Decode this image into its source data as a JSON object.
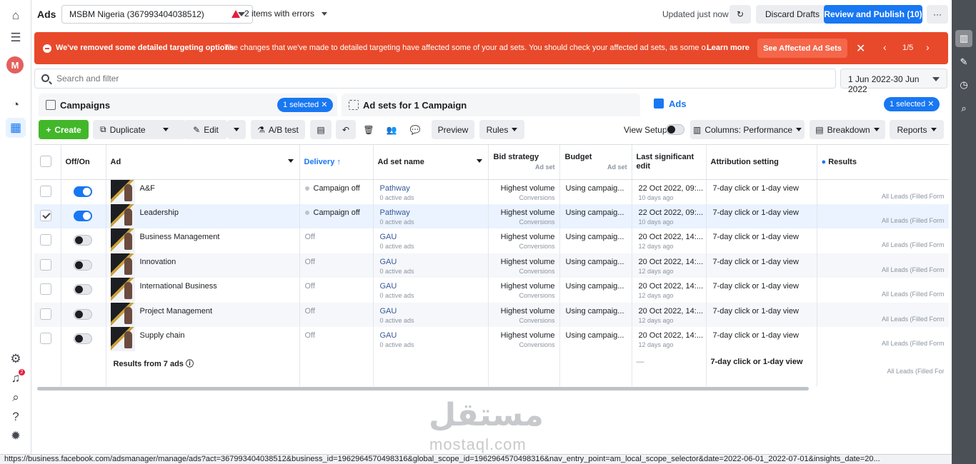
{
  "topbar": {
    "app_title": "Ads",
    "account": "MSBM Nigeria (367993404038512)",
    "errors": "2 items with errors",
    "updated": "Updated just now",
    "discard": "Discard Drafts",
    "review_publish": "Review and Publish (10)",
    "more": "···"
  },
  "banner": {
    "title": "We've removed some detailed targeting options",
    "message": "The changes that we've made to detailed targeting have affected some of your ad sets. You should check your affected ad sets, as some o...",
    "learn_more": "Learn more",
    "see_affected": "See Affected Ad Sets",
    "pager": "1/5"
  },
  "search": {
    "placeholder": "Search and filter",
    "date_range": "1 Jun 2022-30 Jun 2022"
  },
  "tabs": {
    "campaigns": "Campaigns",
    "campaigns_selected": "1 selected",
    "adsets": "Ad sets for 1 Campaign",
    "ads": "Ads",
    "ads_selected": "1 selected"
  },
  "toolbar": {
    "create": "Create",
    "duplicate": "Duplicate",
    "edit": "Edit",
    "ab_test": "A/B test",
    "preview": "Preview",
    "rules": "Rules",
    "view_setup": "View Setup",
    "columns": "Columns: Performance",
    "breakdown": "Breakdown",
    "reports": "Reports"
  },
  "table": {
    "headers": {
      "offon": "Off/On",
      "ad": "Ad",
      "delivery": "Delivery",
      "adset_name": "Ad set name",
      "bid_strategy": "Bid strategy",
      "bid_sub": "Ad set",
      "budget": "Budget",
      "budget_sub": "Ad set",
      "last_edit": "Last significant edit",
      "attribution": "Attribution setting",
      "results": "Results"
    },
    "rows": [
      {
        "ad": "A&F",
        "on": true,
        "selected": false,
        "delivery": "Campaign off",
        "adset": "Pathway",
        "adset_sub": "0 active ads",
        "bid": "Highest volume",
        "bid_sub": "Conversions",
        "budget": "Using campaig...",
        "edit": "22 Oct 2022, 09:...",
        "edit_sub": "10 days ago",
        "attribution": "7-day click or 1-day view",
        "results": "All Leads (Filled Form"
      },
      {
        "ad": "Leadership",
        "on": true,
        "selected": true,
        "delivery": "Campaign off",
        "adset": "Pathway",
        "adset_sub": "0 active ads",
        "bid": "Highest volume",
        "bid_sub": "Conversions",
        "budget": "Using campaig...",
        "edit": "22 Oct 2022, 09:...",
        "edit_sub": "10 days ago",
        "attribution": "7-day click or 1-day view",
        "results": "All Leads (Filled Form"
      },
      {
        "ad": "Business Management",
        "on": false,
        "selected": false,
        "delivery": "Off",
        "adset": "GAU",
        "adset_sub": "0 active ads",
        "bid": "Highest volume",
        "bid_sub": "Conversions",
        "budget": "Using campaig...",
        "edit": "20 Oct 2022, 14:...",
        "edit_sub": "12 days ago",
        "attribution": "7-day click or 1-day view",
        "results": "All Leads (Filled Form"
      },
      {
        "ad": "Innovation",
        "on": false,
        "selected": false,
        "delivery": "Off",
        "adset": "GAU",
        "adset_sub": "0 active ads",
        "bid": "Highest volume",
        "bid_sub": "Conversions",
        "budget": "Using campaig...",
        "edit": "20 Oct 2022, 14:...",
        "edit_sub": "12 days ago",
        "attribution": "7-day click or 1-day view",
        "results": "All Leads (Filled Form"
      },
      {
        "ad": "International Business",
        "on": false,
        "selected": false,
        "delivery": "Off",
        "adset": "GAU",
        "adset_sub": "0 active ads",
        "bid": "Highest volume",
        "bid_sub": "Conversions",
        "budget": "Using campaig...",
        "edit": "20 Oct 2022, 14:...",
        "edit_sub": "12 days ago",
        "attribution": "7-day click or 1-day view",
        "results": "All Leads (Filled Form"
      },
      {
        "ad": "Project Management",
        "on": false,
        "selected": false,
        "delivery": "Off",
        "adset": "GAU",
        "adset_sub": "0 active ads",
        "bid": "Highest volume",
        "bid_sub": "Conversions",
        "budget": "Using campaig...",
        "edit": "20 Oct 2022, 14:...",
        "edit_sub": "12 days ago",
        "attribution": "7-day click or 1-day view",
        "results": "All Leads (Filled Form"
      },
      {
        "ad": "Supply chain",
        "on": false,
        "selected": false,
        "delivery": "Off",
        "adset": "GAU",
        "adset_sub": "0 active ads",
        "bid": "Highest volume",
        "bid_sub": "Conversions",
        "budget": "Using campaig...",
        "edit": "20 Oct 2022, 14:...",
        "edit_sub": "12 days ago",
        "attribution": "7-day click or 1-day view",
        "results": "All Leads (Filled Form"
      }
    ],
    "summary": {
      "label": "Results from 7 ads",
      "edit": "—",
      "attribution": "7-day click or 1-day view",
      "results": "All Leads (Filled For"
    }
  },
  "watermark": {
    "arabic": "مستقل",
    "latin": "mostaql.com"
  },
  "statusbar": {
    "url": "https://business.facebook.com/adsmanager/manage/ads?act=367993404038512&business_id=1962964570498316&global_scope_id=1962964570498316&nav_entry_point=am_local_scope_selector&date=2022-06-01_2022-07-01&insights_date=20..."
  },
  "colors": {
    "accent": "#1877f2",
    "banner": "#e8492a",
    "create": "#42b72a"
  }
}
